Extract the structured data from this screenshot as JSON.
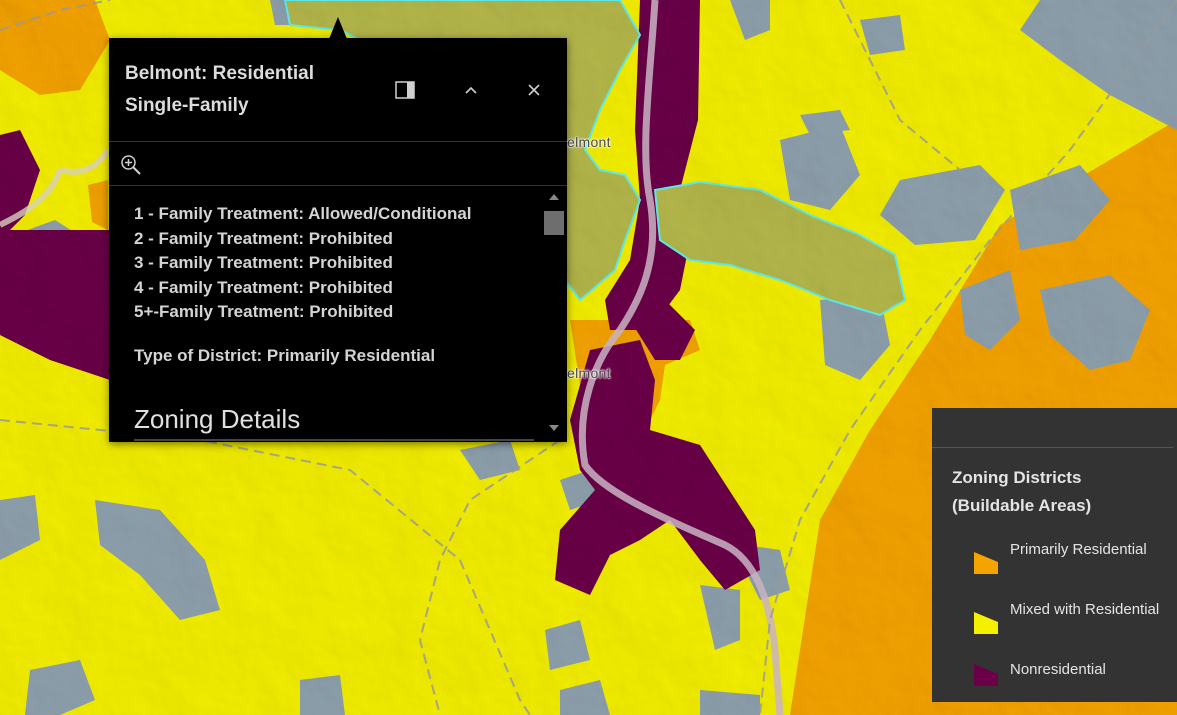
{
  "map": {
    "labels": [
      "elmont",
      "elmont"
    ],
    "colors": {
      "primarily_residential": "#f5a300",
      "mixed_with_residential": "#f5f000",
      "nonresidential": "#6b0048",
      "unzoned": "#8fa1ae",
      "highlight": "#b5b84a",
      "highlight_outline": "#5ff0f0"
    }
  },
  "popup": {
    "title": "Belmont: Residential Single-Family",
    "dock_icon": "dock-icon",
    "collapse_icon": "chevron-up-icon",
    "close_icon": "close-icon",
    "zoom_icon": "zoom-to-icon",
    "attributes": [
      "1 - Family Treatment: Allowed/Conditional",
      "2 - Family Treatment: Prohibited",
      "3 - Family Treatment: Prohibited",
      "4 - Family Treatment: Prohibited",
      "5+-Family Treatment: Prohibited"
    ],
    "district_type": "Type of District: Primarily Residential",
    "section_heading": "Zoning Details"
  },
  "legend": {
    "title": "Zoning Districts (Buildable Areas)",
    "items": [
      {
        "label": "Primarily Residential",
        "color": "#f5a300"
      },
      {
        "label": "Mixed with Residential",
        "color": "#f5f000"
      },
      {
        "label": "Nonresidential",
        "color": "#6b0048"
      }
    ]
  }
}
